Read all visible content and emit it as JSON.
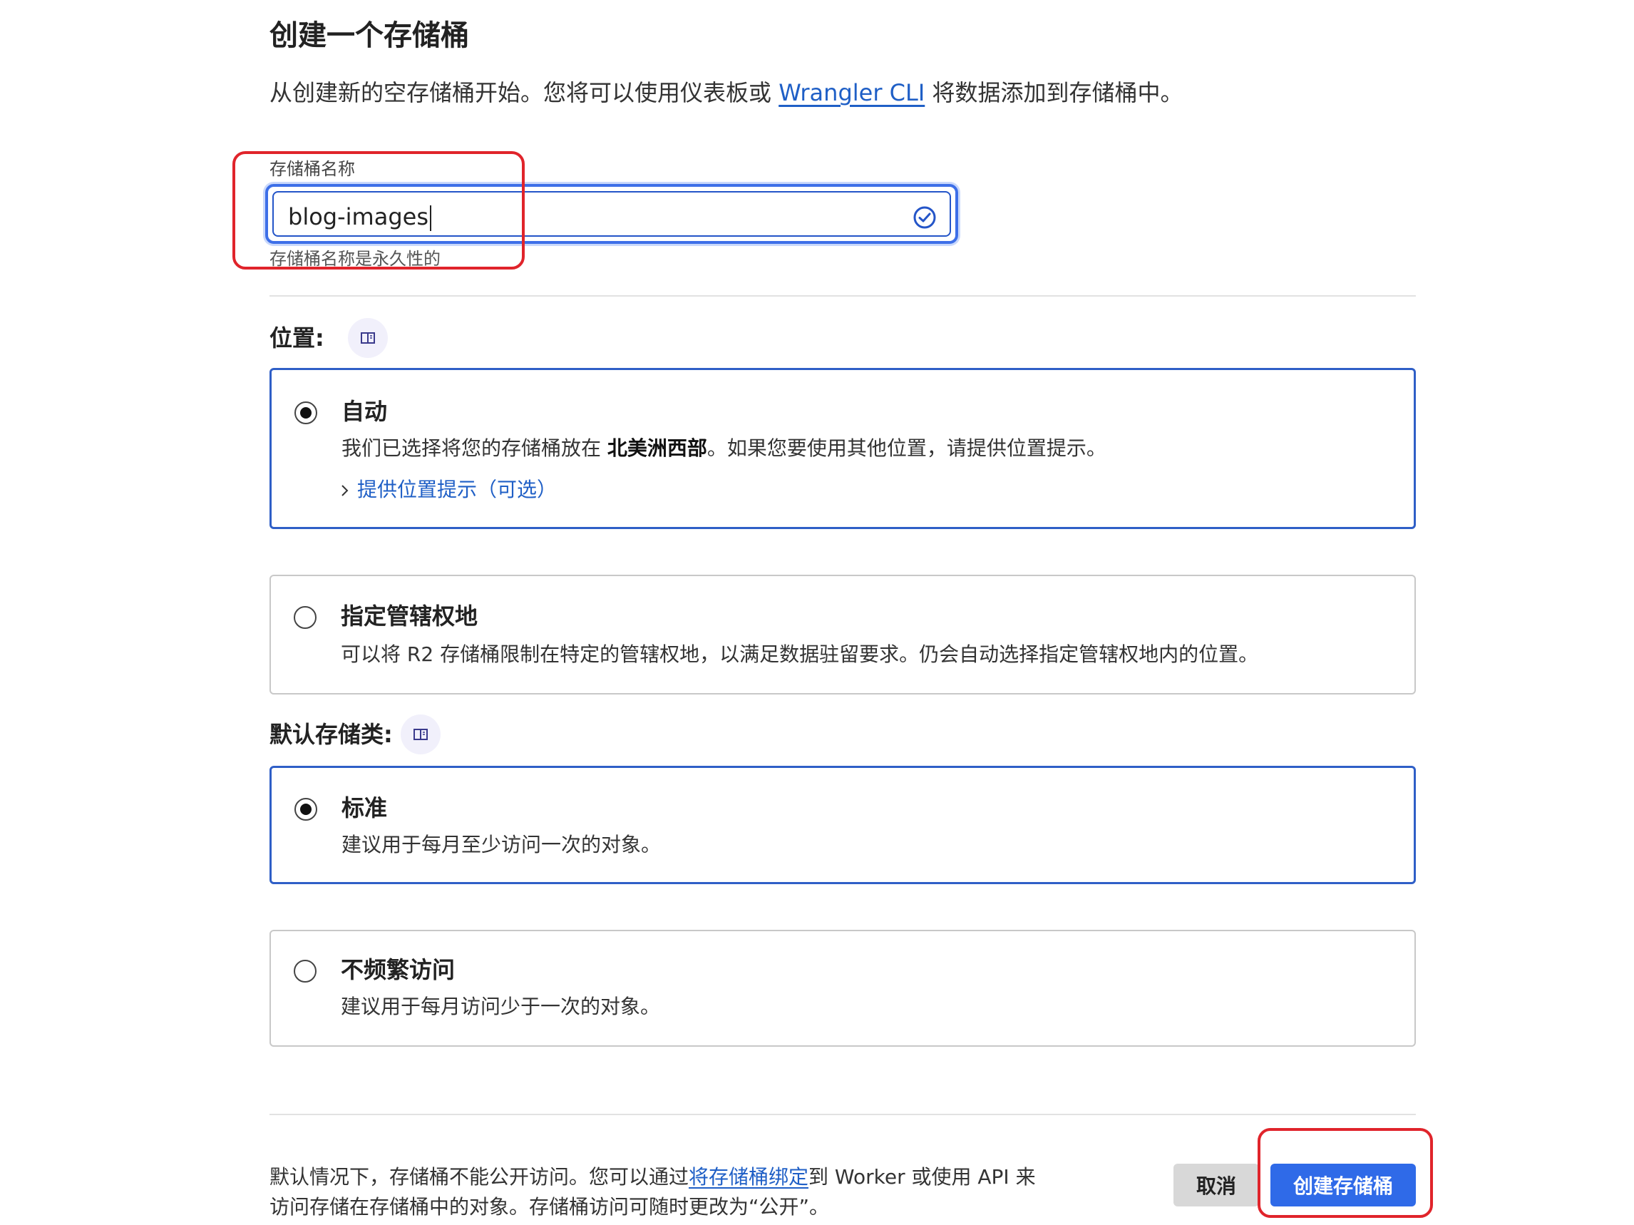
{
  "header": {
    "title": "创建一个存储桶",
    "subtitle_before": "从创建新的空存储桶开始。您将可以使用仪表板或 ",
    "subtitle_link": "Wrangler CLI",
    "subtitle_after": " 将数据添加到存储桶中。"
  },
  "bucket_name": {
    "label": "存储桶名称",
    "value": "blog-images",
    "hint": "存储桶名称是永久性的"
  },
  "location": {
    "label": "位置:",
    "options": [
      {
        "title": "自动",
        "desc_before": "我们已选择将您的存储桶放在 ",
        "desc_bold": "北美洲西部",
        "desc_after": "。如果您要使用其他位置，请提供位置提示。",
        "link": "提供位置提示（可选）",
        "selected": true
      },
      {
        "title": "指定管辖权地",
        "desc": "可以将 R2 存储桶限制在特定的管辖权地，以满足数据驻留要求。仍会自动选择指定管辖权地内的位置。",
        "selected": false
      }
    ]
  },
  "storage_class": {
    "label": "默认存储类:",
    "options": [
      {
        "title": "标准",
        "desc": "建议用于每月至少访问一次的对象。",
        "selected": true
      },
      {
        "title": "不频繁访问",
        "desc": "建议用于每月访问少于一次的对象。",
        "selected": false
      }
    ]
  },
  "footer": {
    "text_before": "默认情况下，存储桶不能公开访问。您可以通过",
    "text_link": "将存储桶绑定",
    "text_after": "到 Worker 或使用 API 来访问存储在存储桶中的对象。存储桶访问可随时更改为“公开”。",
    "cancel_label": "取消",
    "create_label": "创建存储桶"
  },
  "colors": {
    "accent": "#2f6ae8",
    "link": "#1f5fc6",
    "annotation": "#e0242b",
    "selected_border": "#2f5fc7"
  }
}
